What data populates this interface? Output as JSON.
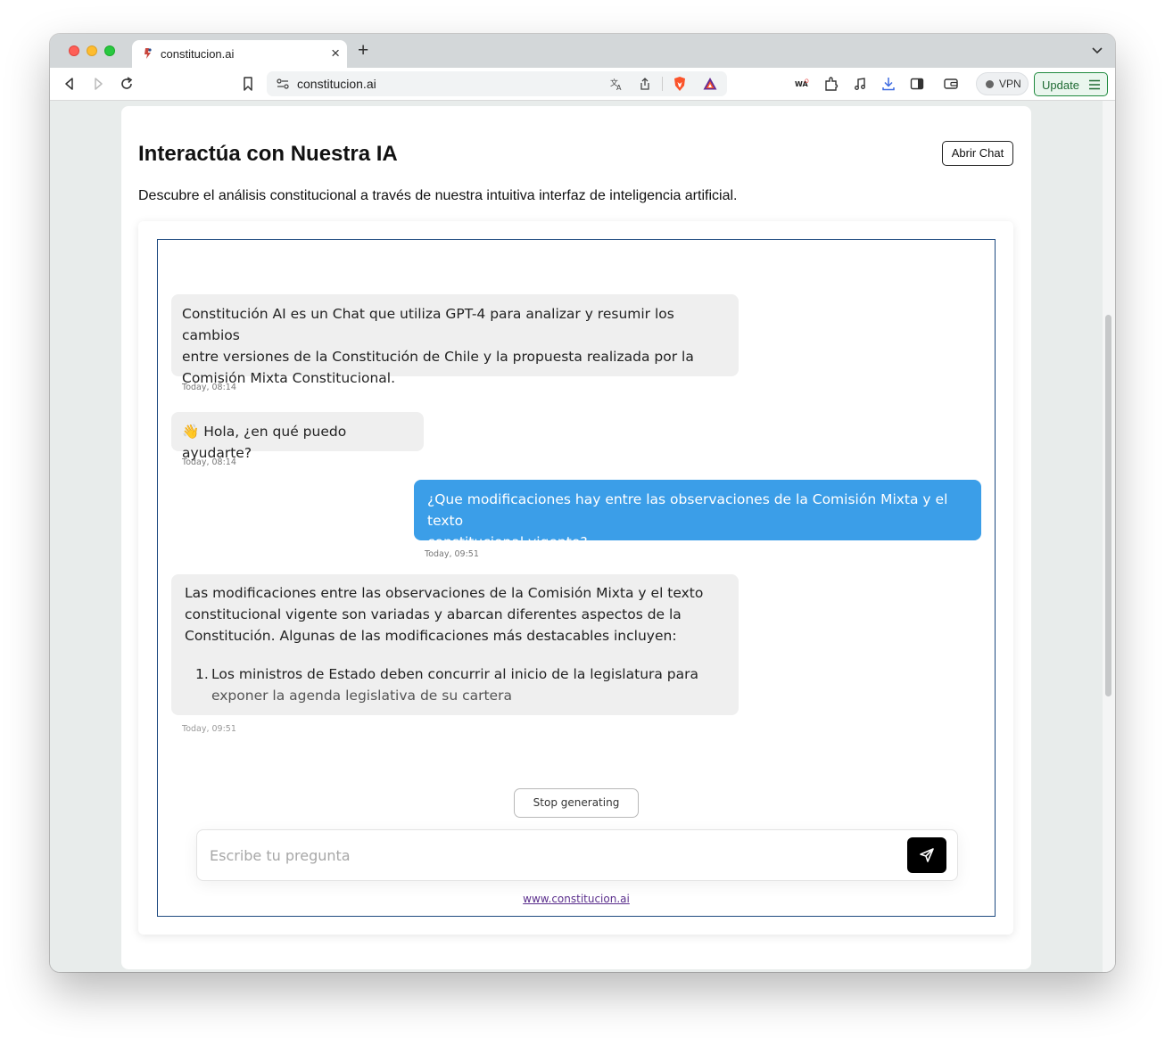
{
  "browser": {
    "tab_title": "constitucion.ai",
    "url": "constitucion.ai",
    "vpn_label": "VPN",
    "update_label": "Update"
  },
  "page": {
    "title": "Interactúa con Nuestra IA",
    "open_chat_label": "Abrir Chat",
    "subtitle": "Descubre el análisis constitucional a través de nuestra intuitiva interfaz de inteligencia artificial."
  },
  "chat": {
    "messages": [
      {
        "role": "bot",
        "lines": [
          "Constitución AI es un Chat que utiliza GPT-4 para analizar y resumir los cambios",
          "entre versiones de la Constitución de Chile y la propuesta realizada por la",
          "Comisión Mixta Constitucional."
        ],
        "time": "Today, 08:14"
      },
      {
        "role": "bot",
        "emoji": "👋",
        "text": "Hola, ¿en qué puedo ayudarte?",
        "time": "Today, 08:14"
      },
      {
        "role": "user",
        "lines": [
          "¿Que modificaciones hay entre las observaciones de la Comisión Mixta y el texto",
          "constitucional vigente?"
        ],
        "time": "Today, 09:51"
      },
      {
        "role": "bot",
        "lines": [
          "Las modificaciones entre las observaciones de la Comisión Mixta y el texto",
          "constitucional vigente son variadas y abarcan diferentes aspectos de la",
          "Constitución. Algunas de las modificaciones más destacables incluyen:"
        ],
        "list_item_number": "1.",
        "list_item_lines": [
          "Los ministros de Estado deben concurrir al inicio de la legislatura para",
          "exponer la agenda legislativa de su cartera"
        ],
        "time": "Today, 09:51"
      }
    ],
    "stop_label": "Stop generating",
    "input_placeholder": "Escribe tu pregunta",
    "input_value": "",
    "footer_link": "www.constitucion.ai"
  },
  "colors": {
    "user_bubble": "#3b9ee8",
    "bot_bubble": "#efefef",
    "frame_border": "#1e4a80",
    "update_green": "#1f8a3e"
  },
  "icons": {
    "tab_favicon": "constitucion-favicon-icon",
    "send": "paper-plane-icon"
  }
}
